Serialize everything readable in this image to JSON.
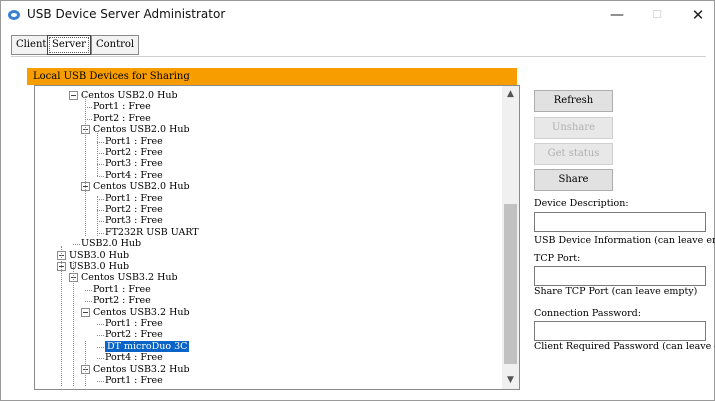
{
  "window": {
    "title": "USB Device Server Administrator",
    "minimize_glyph": "—",
    "maximize_glyph": "☐",
    "close_glyph": "✕"
  },
  "tabs": [
    "Client",
    "Server",
    "Control"
  ],
  "active_tab": "Server",
  "panel": {
    "header": "Local USB Devices for Sharing"
  },
  "tree": [
    {
      "text": "Centos USB2.0 Hub",
      "expander": true
    },
    {
      "text": "Port1 : Free"
    },
    {
      "text": "Port2 : Free"
    },
    {
      "text": "Centos USB2.0 Hub",
      "expander": true
    },
    {
      "text": "Port1 : Free"
    },
    {
      "text": "Port2 : Free"
    },
    {
      "text": "Port3 : Free"
    },
    {
      "text": "Port4 : Free"
    },
    {
      "text": "Centos USB2.0 Hub",
      "expander": true
    },
    {
      "text": "Port1 : Free"
    },
    {
      "text": "Port2 : Free"
    },
    {
      "text": "Port3 : Free"
    },
    {
      "text": "FT232R USB UART"
    },
    {
      "text": "USB2.0 Hub"
    },
    {
      "text": "USB3.0 Hub",
      "expander": true
    },
    {
      "text": "USB3.0 Hub",
      "expander": true
    },
    {
      "text": "Centos USB3.2 Hub",
      "expander": true
    },
    {
      "text": "Port1 : Free"
    },
    {
      "text": "Port2 : Free"
    },
    {
      "text": "Centos USB3.2 Hub",
      "expander": true
    },
    {
      "text": "Port1 : Free"
    },
    {
      "text": "Port2 : Free"
    },
    {
      "text": "DT microDuo 3C",
      "selected": true
    },
    {
      "text": "Port4 : Free"
    },
    {
      "text": "Centos USB3.2 Hub",
      "expander": true
    },
    {
      "text": "Port1 : Free"
    }
  ],
  "buttons": {
    "refresh": "Refresh",
    "unshare": "Unshare",
    "get_status": "Get status",
    "share": "Share"
  },
  "form": {
    "device_description_label": "Device Description:",
    "device_description_value": "",
    "device_description_hint": "USB Device Information (can leave empty)",
    "tcp_port_label": "TCP Port:",
    "tcp_port_value": "",
    "tcp_port_hint": "Share TCP Port (can leave empty)",
    "password_label": "Connection Password:",
    "password_value": "",
    "password_hint": "Client Required Password (can leave empty)"
  },
  "colors": {
    "header_orange": "#f79d00",
    "selection_blue": "#0a64c8"
  },
  "icons": {
    "app": "network-device-icon",
    "scroll_up": "▲",
    "scroll_down": "▼"
  }
}
